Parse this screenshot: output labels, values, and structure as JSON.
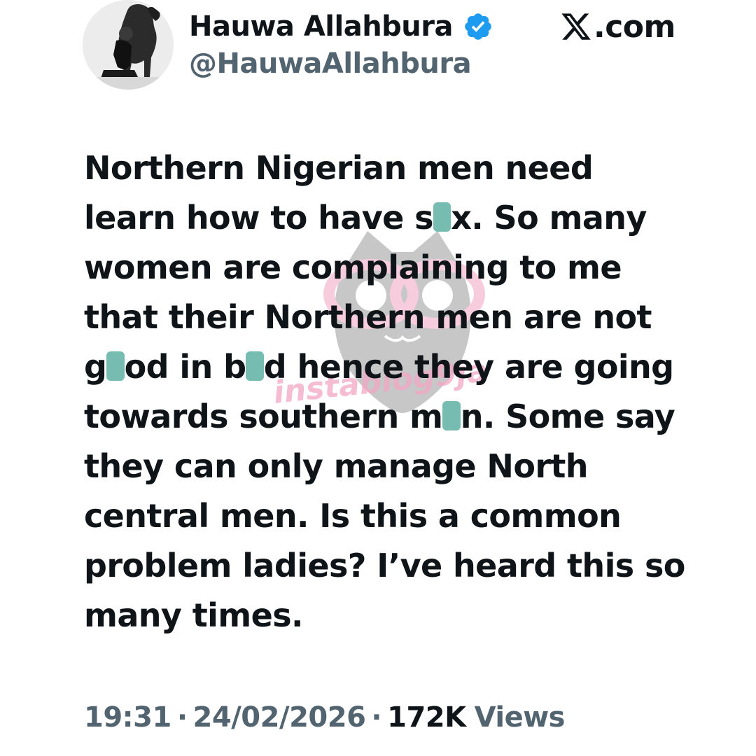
{
  "author": {
    "display_name": "Hauwa Allahbura",
    "handle": "@HauwaAllahbura",
    "verified": true
  },
  "site": {
    "label": ".com",
    "logo_icon": "x-logo-icon"
  },
  "tweet": {
    "lines": [
      [
        "Northern Nigerian men need"
      ],
      [
        "learn how to have s",
        "x. So many"
      ],
      [
        "women are complaining to me"
      ],
      [
        "that their Northern men are not"
      ],
      [
        "g",
        "od in b",
        "d hence they are going"
      ],
      [
        "towards southern m",
        "n. Some say"
      ],
      [
        "they can only manage North"
      ],
      [
        "central men. Is this a common"
      ],
      [
        "problem ladies? I’ve heard this so"
      ],
      [
        "many times."
      ]
    ]
  },
  "watermark": {
    "text": "instablog9ja"
  },
  "meta": {
    "time": "19:31",
    "date": "24/02/2026",
    "views_count": "172K",
    "views_label": "Views",
    "separator": "·"
  },
  "colors": {
    "text_primary": "#0f1419",
    "text_secondary": "#536471",
    "verified": "#1d9bf0",
    "censor": "#6fb8ad",
    "watermark_pink": "#f2a6c4",
    "watermark_gray": "#9a9a9a"
  }
}
